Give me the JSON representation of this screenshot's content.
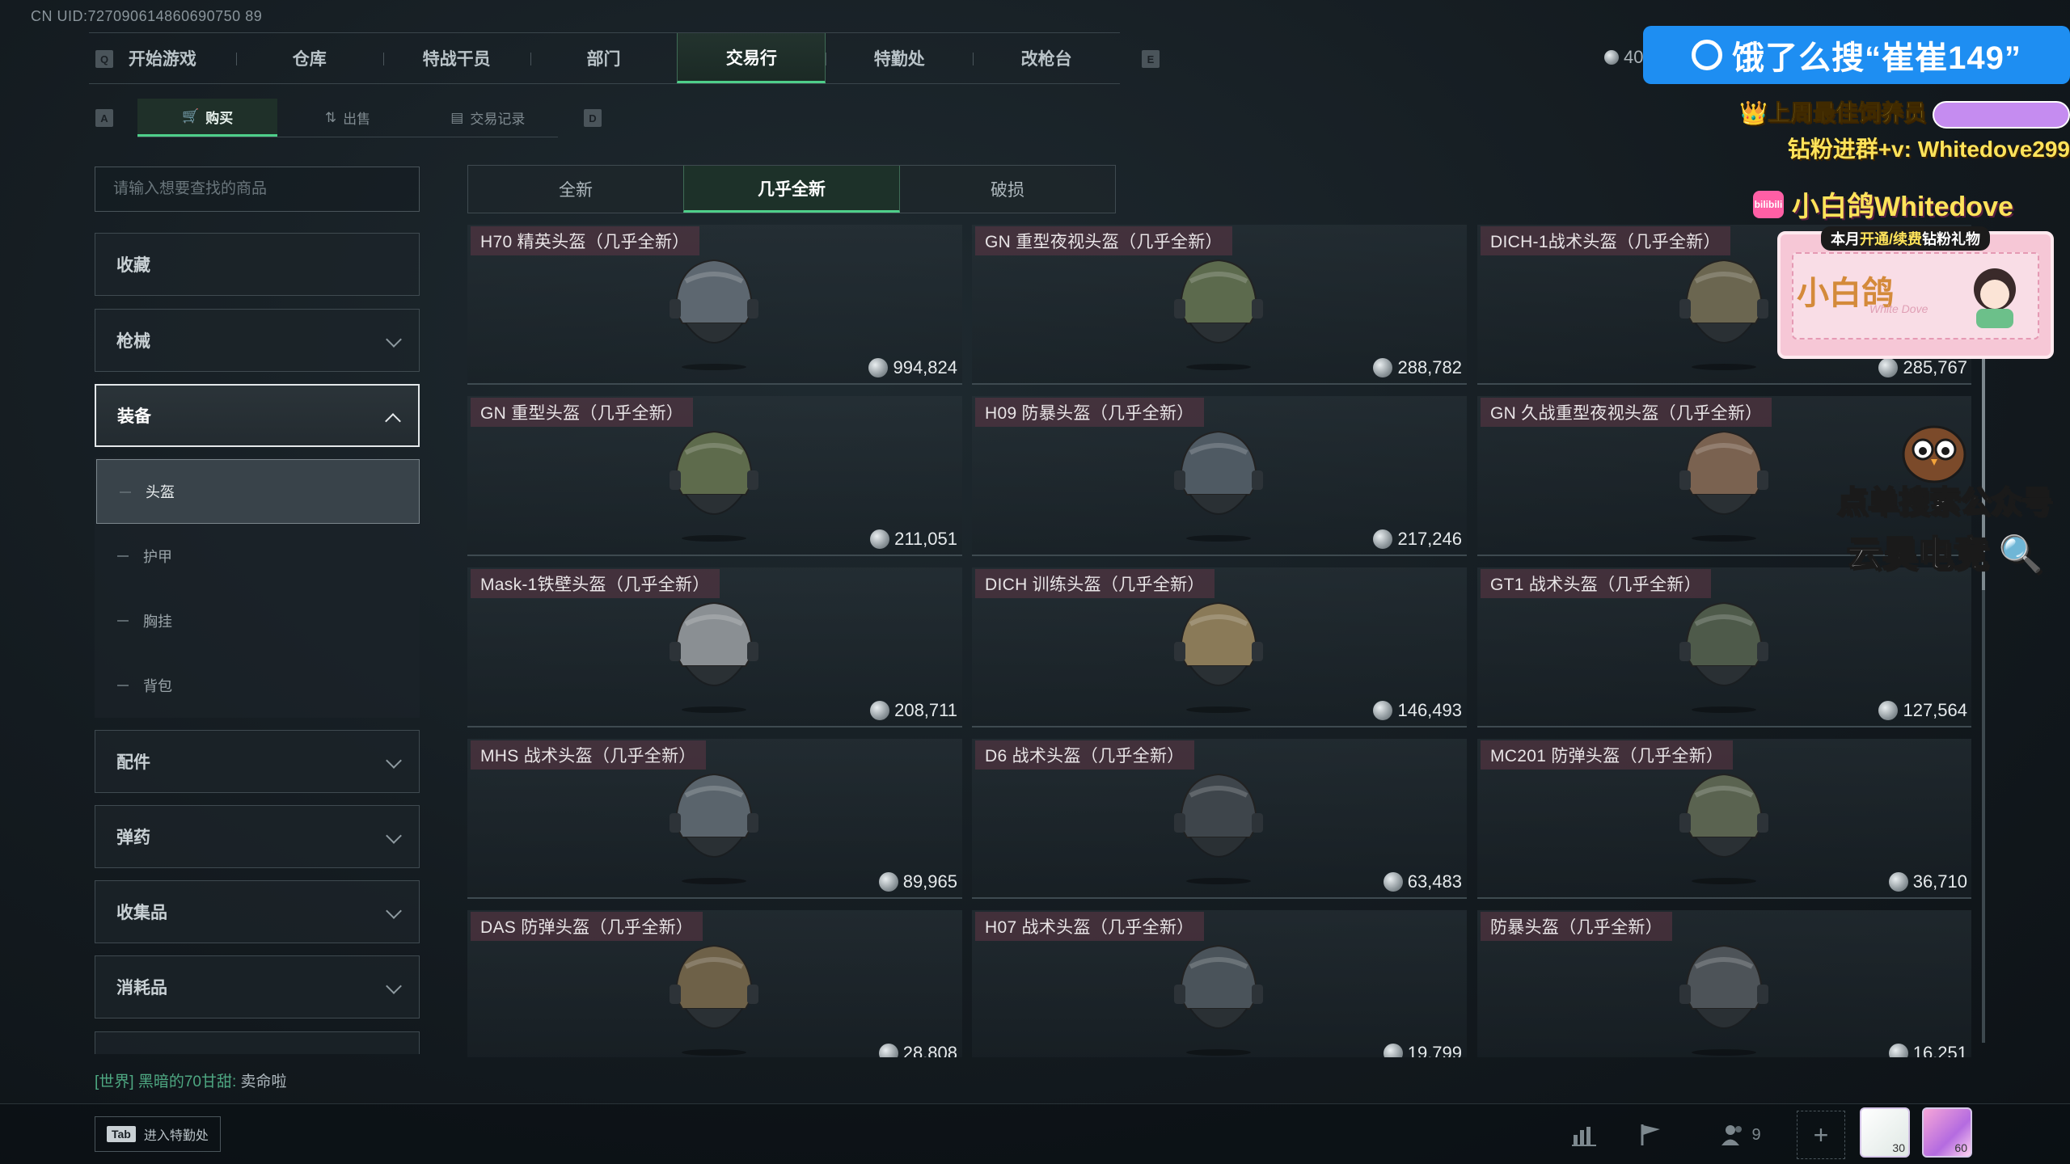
{
  "uid": "CN UID:727090614860690750 89",
  "nav": {
    "left_key": "Q",
    "right_key": "E",
    "tabs": [
      "开始游戏",
      "仓库",
      "特战干员",
      "部门",
      "交易行",
      "特勤处",
      "改枪台"
    ],
    "active": "交易行",
    "currency_partial": "40"
  },
  "subnav": {
    "left_key": "A",
    "right_key": "D",
    "tabs": [
      "购买",
      "出售",
      "交易记录"
    ],
    "active": "购买"
  },
  "search": {
    "placeholder": "请输入想要查找的商品"
  },
  "sidebar": {
    "categories": [
      "收藏",
      "枪械",
      "装备",
      "配件",
      "弹药",
      "收集品",
      "消耗品"
    ],
    "open": "装备",
    "subcategories": [
      "头盔",
      "护甲",
      "胸挂",
      "背包"
    ],
    "active_sub": "头盔"
  },
  "condition_tabs": [
    "全新",
    "几乎全新",
    "破损"
  ],
  "condition_active": "几乎全新",
  "items": [
    {
      "name": "H70 精英头盔（几乎全新）",
      "price": "994,824",
      "color": "#5d6770"
    },
    {
      "name": "GN 重型夜视头盔（几乎全新）",
      "price": "288,782",
      "color": "#5c6a4d"
    },
    {
      "name": "DICH-1战术头盔（几乎全新）",
      "price": "285,767",
      "color": "#6b6650"
    },
    {
      "name": "GN 重型头盔（几乎全新）",
      "price": "211,051",
      "color": "#5e6b4c"
    },
    {
      "name": "H09 防暴头盔（几乎全新）",
      "price": "217,246",
      "color": "#4f5a63"
    },
    {
      "name": "GN 久战重型夜视头盔（几乎全新）",
      "price": "",
      "color": "#7a6250"
    },
    {
      "name": "Mask-1铁壁头盔（几乎全新）",
      "price": "208,711",
      "color": "#8a8f93"
    },
    {
      "name": "DICH 训练头盔（几乎全新）",
      "price": "146,493",
      "color": "#8a7a58"
    },
    {
      "name": "GT1 战术头盔（几乎全新）",
      "price": "127,564",
      "color": "#4e5a4a"
    },
    {
      "name": "MHS 战术头盔（几乎全新）",
      "price": "89,965",
      "color": "#5a646c"
    },
    {
      "name": "D6 战术头盔（几乎全新）",
      "price": "63,483",
      "color": "#3e454b"
    },
    {
      "name": "MC201 防弹头盔（几乎全新）",
      "price": "36,710",
      "color": "#5a6350"
    },
    {
      "name": "DAS 防弹头盔（几乎全新）",
      "price": "28,808",
      "color": "#6e6148"
    },
    {
      "name": "H07 战术头盔（几乎全新）",
      "price": "19,799",
      "color": "#4a535a"
    },
    {
      "name": "防暴头盔（几乎全新）",
      "price": "16,251",
      "color": "#4d5358"
    }
  ],
  "chat": {
    "channel": "[世界]",
    "user": "黑暗的70甘甜:",
    "message": "卖命啦"
  },
  "bottom": {
    "tab_key": "Tab",
    "tab_label": "进入特勤处",
    "friends_count": "9",
    "avatar1_level": "30",
    "avatar2_level": "60"
  },
  "overlay": {
    "ad_text": "饿了么搜“崔崔149”",
    "line1": "上周最佳饲养员",
    "line2": "钻粉进群+v: Whitedove299",
    "handle": "小白鸽Whitedove",
    "bili": "bilibili",
    "gift_title_pre": "本月",
    "gift_title_hl": "开通/续费",
    "gift_title_post": "钻粉礼物",
    "gift_name": "小白鸽",
    "gift_sub": "White Dove",
    "promo1": "点单搜索公众号",
    "promo2": "云昊电竞"
  }
}
